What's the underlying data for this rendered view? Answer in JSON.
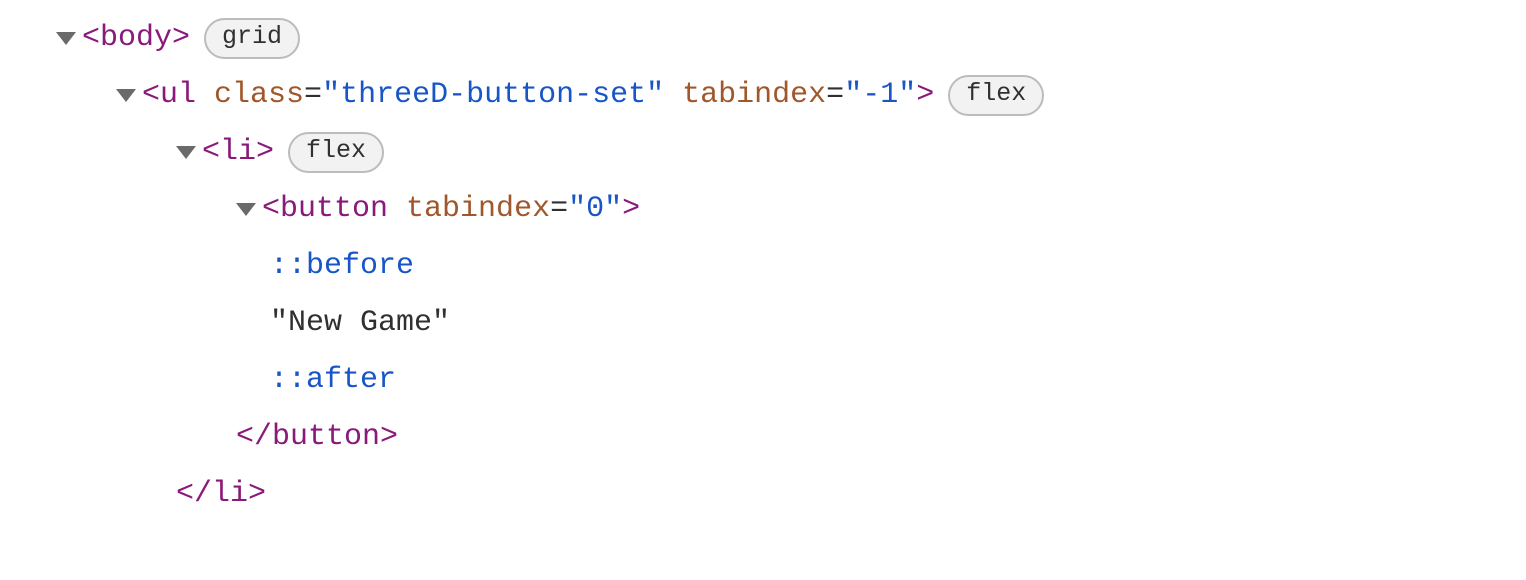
{
  "tree": {
    "row0": {
      "open": "<body>",
      "badge": "grid"
    },
    "row1": {
      "tag_open": "<ul",
      "attr_class_name": "class",
      "attr_class_val": "\"threeD-button-set\"",
      "attr_tabindex_name": "tabindex",
      "attr_tabindex_val": "\"-1\"",
      "tag_close": ">",
      "badge": "flex"
    },
    "row2": {
      "open": "<li>",
      "badge": "flex"
    },
    "row3": {
      "tag_open": "<button",
      "attr_tabindex_name": "tabindex",
      "attr_tabindex_val": "\"0\"",
      "tag_close": ">"
    },
    "row4": {
      "pseudo": "::before"
    },
    "row5": {
      "text": "\"New Game\""
    },
    "row6": {
      "pseudo": "::after"
    },
    "row7": {
      "close": "</button>"
    },
    "row8": {
      "close": "</li>"
    }
  }
}
